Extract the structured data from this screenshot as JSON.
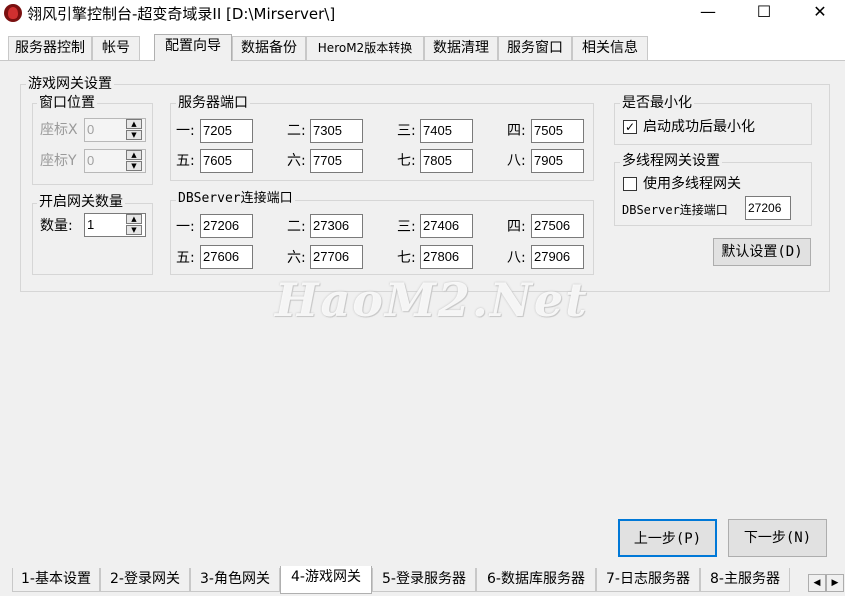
{
  "window": {
    "title": "翎风引擎控制台-超变奇域录II [D:\\Mirserver\\]",
    "minimize": "—",
    "maximize": "☐",
    "close": "✕"
  },
  "top_tabs": [
    "服务器控制",
    "帐号",
    "配置向导",
    "数据备份",
    "HeroM2版本转换",
    "数据清理",
    "服务窗口",
    "相关信息"
  ],
  "group": {
    "title": "游戏网关设置",
    "window_position": {
      "title": "窗口位置",
      "x_label": "座标X",
      "x_value": "0",
      "y_label": "座标Y",
      "y_value": "0"
    },
    "gateway_count": {
      "title": "开启网关数量",
      "label": "数量:",
      "value": "1"
    },
    "server_ports": {
      "title": "服务器端口",
      "labels": [
        "一:",
        "二:",
        "三:",
        "四:",
        "五:",
        "六:",
        "七:",
        "八:"
      ],
      "values": [
        "7205",
        "7305",
        "7405",
        "7505",
        "7605",
        "7705",
        "7805",
        "7905"
      ]
    },
    "db_ports": {
      "title": "DBServer连接端口",
      "labels": [
        "一:",
        "二:",
        "三:",
        "四:",
        "五:",
        "六:",
        "七:",
        "八:"
      ],
      "values": [
        "27206",
        "27306",
        "27406",
        "27506",
        "27606",
        "27706",
        "27806",
        "27906"
      ]
    },
    "minimize": {
      "title": "是否最小化",
      "checkbox_label": "启动成功后最小化",
      "checked": true
    },
    "multithread": {
      "title": "多线程网关设置",
      "checkbox_label": "使用多线程网关",
      "checked": false,
      "db_label": "DBServer连接端口",
      "db_value": "27206"
    },
    "default_button": "默认设置(D)"
  },
  "watermark": "HaoM2.Net",
  "nav": {
    "prev": "上一步(P)",
    "next": "下一步(N)"
  },
  "bottom_tabs": [
    "1-基本设置",
    "2-登录网关",
    "3-角色网关",
    "4-游戏网关",
    "5-登录服务器",
    "6-数据库服务器",
    "7-日志服务器",
    "8-主服务器"
  ],
  "scroll": {
    "left": "◀",
    "right": "▶"
  }
}
